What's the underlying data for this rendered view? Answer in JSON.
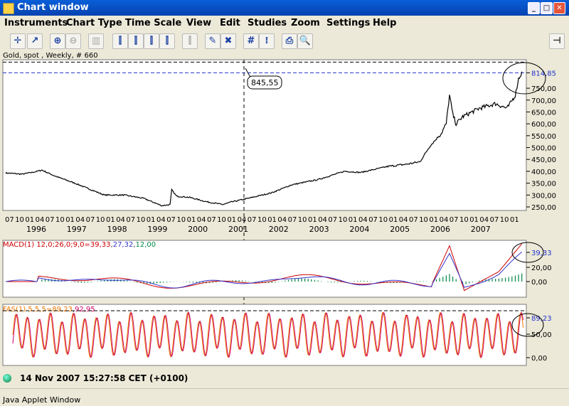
{
  "window": {
    "title": "Chart window",
    "footer": "Java Applet Window",
    "status": "14 Nov 2007 15:27:58  CET (+0100)"
  },
  "menu": [
    "Instruments",
    "Chart Type",
    "Time Scale",
    "View",
    "Edit",
    "Studies",
    "Zoom",
    "Settings",
    "Help"
  ],
  "toolbar": [
    {
      "name": "crosshair-button",
      "glyph": "✛",
      "enabled": true
    },
    {
      "name": "draw-trend-button",
      "glyph": "↗",
      "enabled": true
    },
    {
      "name": "zoom-in-button",
      "glyph": "⊕",
      "enabled": true
    },
    {
      "name": "zoom-out-button",
      "glyph": "⊖",
      "enabled": false
    },
    {
      "name": "bar-view-button",
      "glyph": "▥",
      "enabled": false
    },
    {
      "name": "ohlc-1-button",
      "glyph": "⫿",
      "enabled": true
    },
    {
      "name": "ohlc-2-button",
      "glyph": "⫿",
      "enabled": true
    },
    {
      "name": "ohlc-3-button",
      "glyph": "⫿",
      "enabled": true
    },
    {
      "name": "ohlc-4-button",
      "glyph": "⫿",
      "enabled": true
    },
    {
      "name": "ohlc-disabled-button",
      "glyph": "⫿",
      "enabled": false
    },
    {
      "name": "eraser-button",
      "glyph": "✎",
      "enabled": true
    },
    {
      "name": "delete-button",
      "glyph": "✖",
      "enabled": true
    },
    {
      "name": "grid-button",
      "glyph": "#",
      "enabled": true
    },
    {
      "name": "studies-button",
      "glyph": "⁞",
      "enabled": true
    },
    {
      "name": "print-button",
      "glyph": "⎙",
      "enabled": true
    },
    {
      "name": "print-preview-button",
      "glyph": "🔍",
      "enabled": true
    }
  ],
  "chart_data": [
    {
      "type": "line",
      "title": "Gold, spot , Weekly, # 660",
      "ylim": [
        235,
        870
      ],
      "y_ticks": [
        "250,00",
        "300,00",
        "350,00",
        "400,00",
        "450,00",
        "500,00",
        "550,00",
        "600,00",
        "650,00",
        "700,00",
        "750,00",
        "814,85"
      ],
      "last_value": "814,85",
      "cursor_value": "845,55",
      "x_year_labels": [
        "1996",
        "1997",
        "1998",
        "1999",
        "2000",
        "2001",
        "2002",
        "2003",
        "2004",
        "2005",
        "2006",
        "2007"
      ],
      "x_month_labels": [
        "04",
        "07",
        "10",
        "01"
      ],
      "anchors": [
        {
          "t": 0,
          "v": 393
        },
        {
          "t": 10,
          "v": 388
        },
        {
          "t": 18,
          "v": 398
        },
        {
          "t": 22,
          "v": 405
        },
        {
          "t": 30,
          "v": 380
        },
        {
          "t": 42,
          "v": 350
        },
        {
          "t": 60,
          "v": 300
        },
        {
          "t": 72,
          "v": 300
        },
        {
          "t": 84,
          "v": 286
        },
        {
          "t": 95,
          "v": 255
        },
        {
          "t": 100,
          "v": 260
        },
        {
          "t": 101,
          "v": 322
        },
        {
          "t": 104,
          "v": 295
        },
        {
          "t": 112,
          "v": 290
        },
        {
          "t": 122,
          "v": 272
        },
        {
          "t": 132,
          "v": 260
        },
        {
          "t": 137,
          "v": 270
        },
        {
          "t": 150,
          "v": 290
        },
        {
          "t": 162,
          "v": 310
        },
        {
          "t": 174,
          "v": 343
        },
        {
          "t": 190,
          "v": 365
        },
        {
          "t": 206,
          "v": 400
        },
        {
          "t": 216,
          "v": 395
        },
        {
          "t": 232,
          "v": 420
        },
        {
          "t": 244,
          "v": 430
        },
        {
          "t": 252,
          "v": 440
        },
        {
          "t": 258,
          "v": 505
        },
        {
          "t": 265,
          "v": 560
        },
        {
          "t": 268,
          "v": 600
        },
        {
          "t": 270,
          "v": 720
        },
        {
          "t": 272,
          "v": 640
        },
        {
          "t": 274,
          "v": 600
        },
        {
          "t": 278,
          "v": 630
        },
        {
          "t": 288,
          "v": 665
        },
        {
          "t": 298,
          "v": 685
        },
        {
          "t": 305,
          "v": 665
        },
        {
          "t": 310,
          "v": 720
        },
        {
          "t": 312,
          "v": 790
        },
        {
          "t": 314,
          "v": 815
        }
      ]
    },
    {
      "type": "line",
      "title": "MACD(1) 12,0;26,0;9,0",
      "series": [
        {
          "name": "39,33",
          "color": "#cc0000"
        },
        {
          "name": "27,32",
          "color": "#3333cc"
        },
        {
          "name": "12,00",
          "color": "#008844"
        }
      ],
      "y_ticks": [
        "39,33",
        "20,00",
        "0,00"
      ],
      "ylim": [
        -15,
        45
      ]
    },
    {
      "type": "line",
      "title": "FAS(1) 5,5,5",
      "series": [
        {
          "name": "89,23",
          "color": "#ee7700"
        },
        {
          "name": "92,95",
          "color": "#cc0066"
        }
      ],
      "y_ticks": [
        "89,23",
        "50,00",
        "0,00"
      ],
      "ylim": [
        -10,
        110
      ]
    }
  ],
  "labels": {
    "macd_prefix": "MACD(1) 12,0;26,0;9,0=",
    "macd_v1": "39,33",
    "macd_v2": "27,32",
    "macd_v3": "12,00",
    "fas_prefix": "FAS(1) 5,5,5=",
    "fas_v1": "89,23",
    "fas_v2": "92,95"
  }
}
